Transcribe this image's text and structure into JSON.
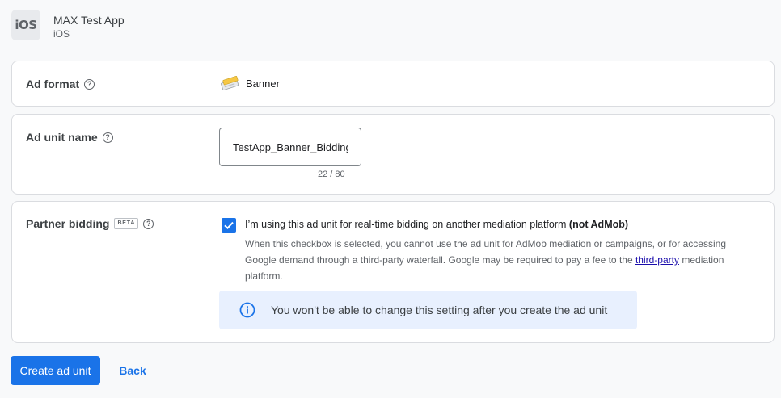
{
  "app": {
    "icon_text": "iOS",
    "name": "MAX Test App",
    "platform": "iOS"
  },
  "ad_format": {
    "label": "Ad format",
    "value": "Banner",
    "icon": "banner-icon"
  },
  "ad_unit_name": {
    "label": "Ad unit name",
    "value": "TestApp_Banner_Bidding",
    "char_count": "22 / 80"
  },
  "partner_bidding": {
    "label": "Partner bidding",
    "badge": "BETA",
    "checked": true,
    "checkbox_label": "I’m using this ad unit for real-time bidding on another mediation platform",
    "checkbox_label_bold": "(not AdMob)",
    "description_before": "When this checkbox is selected, you cannot use the ad unit for AdMob mediation or campaigns, or for accessing Google demand through a third-party waterfall. Google may be required to pay a fee to the",
    "description_link": "third-party",
    "description_after": "mediation platform.",
    "info_text": "You won't be able to change this setting after you create the ad unit"
  },
  "actions": {
    "create_label": "Create ad unit",
    "back_label": "Back"
  },
  "colors": {
    "accent": "#1a73e8",
    "info_bg": "#e8f0fe",
    "link": "#1a0dab"
  }
}
